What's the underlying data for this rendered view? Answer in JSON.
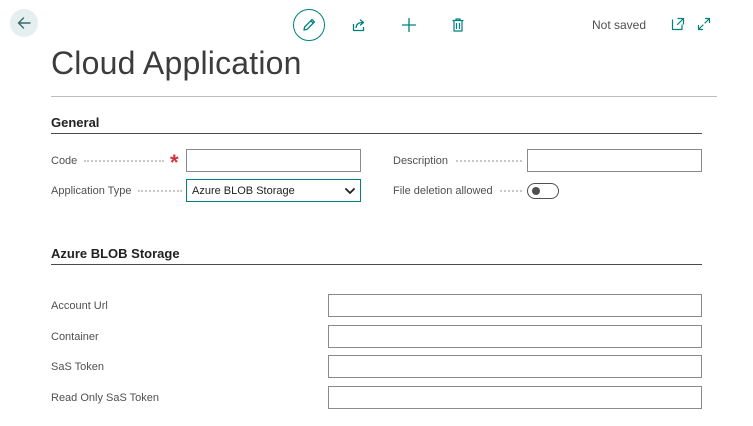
{
  "header": {
    "status": "Not saved",
    "title": "Cloud Application"
  },
  "general": {
    "section_title": "General",
    "code": {
      "label": "Code",
      "value": ""
    },
    "description": {
      "label": "Description",
      "value": ""
    },
    "application_type": {
      "label": "Application Type",
      "value": "Azure BLOB Storage"
    },
    "file_deletion": {
      "label": "File deletion allowed",
      "value": false
    }
  },
  "azure": {
    "section_title": "Azure BLOB Storage",
    "account_url": {
      "label": "Account Url",
      "value": ""
    },
    "container": {
      "label": "Container",
      "value": ""
    },
    "sas_token": {
      "label": "SaS Token",
      "value": ""
    },
    "read_only_sas_token": {
      "label": "Read Only SaS Token",
      "value": ""
    }
  },
  "colors": {
    "accent": "#00807f",
    "required": "#d13438"
  },
  "icons": {
    "back": "arrow-left-icon",
    "edit": "pencil-icon",
    "share": "share-icon",
    "new": "plus-icon",
    "delete": "trash-icon",
    "open_new_window": "open-new-window-icon",
    "expand": "expand-icon"
  }
}
